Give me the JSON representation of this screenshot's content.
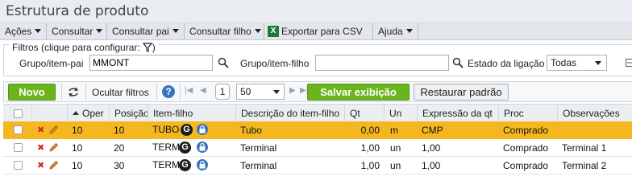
{
  "window": {
    "title": "Estrutura de produto"
  },
  "menu": [
    {
      "label": "Ações",
      "dropdown": true
    },
    {
      "label": "Consultar",
      "dropdown": true
    },
    {
      "label": "Consultar pai",
      "dropdown": true
    },
    {
      "label": "Consultar filho",
      "dropdown": true
    },
    {
      "label": "Exportar para CSV",
      "dropdown": false,
      "icon": "excel-icon"
    },
    {
      "label": "Ajuda",
      "dropdown": true
    }
  ],
  "filters": {
    "legend": "Filtros (clique para configurar:",
    "parent_label": "Grupo/item-pai",
    "parent_value": "MMONT",
    "child_label": "Grupo/item-filho",
    "child_value": "",
    "link_state_label": "Estado da ligação",
    "link_state_value": "Todas"
  },
  "toolbar": {
    "new_label": "Novo",
    "hide_filters_label": "Ocultar filtros",
    "help_label": "?",
    "page_number": "1",
    "page_size": "50",
    "save_view_label": "Salvar exibição",
    "restore_label": "Restaurar padrão"
  },
  "grid": {
    "columns": [
      "Oper",
      "Posição",
      "Item-filho",
      "Descrição do item-filho",
      "Qt",
      "Un",
      "Expressão da qt",
      "Proc",
      "Observações"
    ],
    "rows": [
      {
        "oper": "10",
        "posicao": "10",
        "item": "TUBO",
        "descricao": "Tubo",
        "qt": "0,00",
        "un": "m",
        "expressao": "CMP",
        "proc": "Comprado",
        "obs": "",
        "selected": true
      },
      {
        "oper": "10",
        "posicao": "20",
        "item": "TERM",
        "descricao": "Terminal",
        "qt": "1,00",
        "un": "un",
        "expressao": "1,00",
        "proc": "Comprado",
        "obs": "Terminal 1",
        "selected": false
      },
      {
        "oper": "10",
        "posicao": "30",
        "item": "TERM",
        "descricao": "Terminal",
        "qt": "1,00",
        "un": "un",
        "expressao": "1,00",
        "proc": "Comprado",
        "obs": "Terminal 2",
        "selected": false
      }
    ],
    "g_badge": "G"
  },
  "colors": {
    "accent_green": "#6ab41e",
    "selected_row": "#f5b71f",
    "icon_blue": "#3a72c2",
    "delete_red": "#d22b2b"
  }
}
